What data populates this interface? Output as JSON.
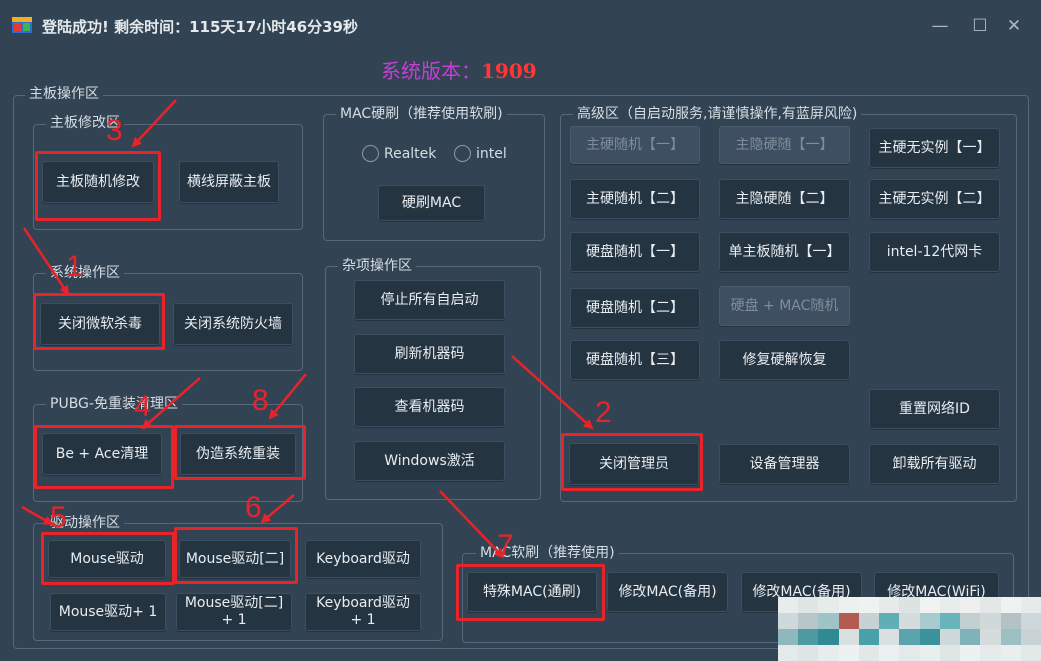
{
  "window": {
    "title": "登陆成功! 剩余时间：115天17小时46分39秒",
    "version_label": "系统版本：",
    "version_number": "1909",
    "minimize": "—",
    "maximize": "☐",
    "close": "✕"
  },
  "motherboard_area": {
    "title": "主板操作区",
    "modify": {
      "title": "主板修改区",
      "buttons": [
        "主板随机修改",
        "横线屏蔽主板"
      ]
    },
    "system": {
      "title": "系统操作区",
      "buttons": [
        "关闭微软杀毒",
        "关闭系统防火墙"
      ]
    },
    "pubg": {
      "title": "PUBG-免重装清理区",
      "buttons": [
        "Be + Ace清理",
        "伪造系统重装"
      ]
    }
  },
  "mac_hw": {
    "title": "MAC硬刷（推荐使用软刷)",
    "radios": [
      "Realtek",
      "intel"
    ],
    "button": "硬刷MAC"
  },
  "misc": {
    "title": "杂项操作区",
    "buttons": [
      "停止所有自启动",
      "刷新机器码",
      "查看机器码",
      "Windows激活"
    ]
  },
  "advanced": {
    "title": "高级区（自启动服务,请谨慎操作,有蓝屏风险)",
    "buttons": [
      "主硬随机【一】",
      "主隐硬随【一】",
      "主硬无实例【一】",
      "主硬随机【二】",
      "主隐硬随【二】",
      "主硬无实例【二】",
      "硬盘随机【一】",
      "单主板随机【一】",
      "intel-12代网卡",
      "硬盘随机【二】",
      "硬盘 + MAC随机",
      "硬盘随机【三】",
      "修复硬解恢复",
      "重置网络ID",
      "关闭管理员",
      "设备管理器",
      "卸载所有驱动"
    ]
  },
  "driver": {
    "title": "驱动操作区",
    "buttons": [
      "Mouse驱动",
      "Mouse驱动[二]",
      "Keyboard驱动",
      "Mouse驱动+ 1",
      "Mouse驱动[二]\n+ 1",
      "Keyboard驱动\n+ 1"
    ]
  },
  "mac_sw": {
    "title": "MAC软刷（推荐使用)",
    "buttons": [
      "特殊MAC(通刷)",
      "修改MAC(备用)",
      "修改MAC(备用)",
      "修改MAC(WiFi)"
    ]
  },
  "annotations": [
    "1",
    "2",
    "3",
    "4",
    "5",
    "6",
    "7",
    "8"
  ],
  "colors": {
    "background": "#324353",
    "button": "#253441",
    "button_disabled": "#3d4f60",
    "annotation_red": "#e8232a",
    "version_label": "#c43fd6",
    "version_number": "#ff3737"
  }
}
